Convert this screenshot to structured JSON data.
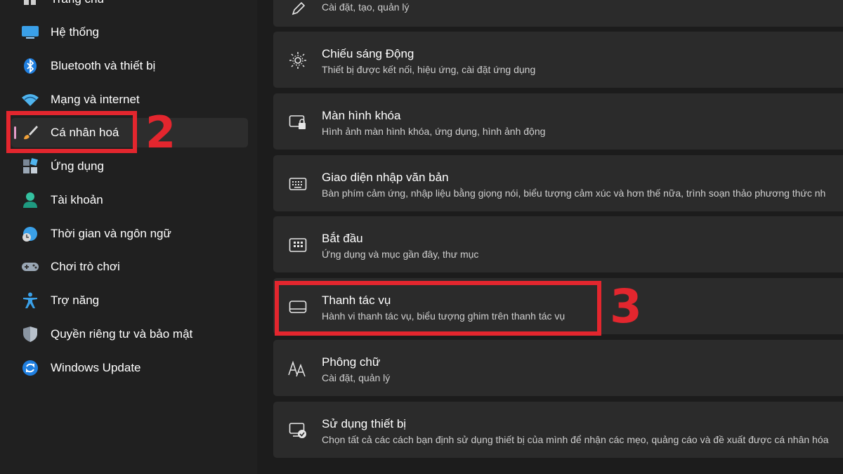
{
  "sidebar": {
    "items": [
      {
        "label": "Trang chủ",
        "icon": "home-icon"
      },
      {
        "label": "Hệ thống",
        "icon": "system-icon"
      },
      {
        "label": "Bluetooth và thiết bị",
        "icon": "bluetooth-icon"
      },
      {
        "label": "Mạng và internet",
        "icon": "wifi-icon"
      },
      {
        "label": "Cá nhân hoá",
        "icon": "brush-icon",
        "active": true
      },
      {
        "label": "Ứng dụng",
        "icon": "apps-icon"
      },
      {
        "label": "Tài khoản",
        "icon": "account-icon"
      },
      {
        "label": "Thời gian và ngôn ngữ",
        "icon": "time-language-icon"
      },
      {
        "label": "Chơi trò chơi",
        "icon": "gamepad-icon"
      },
      {
        "label": "Trợ năng",
        "icon": "accessibility-icon"
      },
      {
        "label": "Quyền riêng tư và bảo mật",
        "icon": "shield-icon"
      },
      {
        "label": "Windows Update",
        "icon": "update-icon"
      }
    ]
  },
  "main": {
    "top_subtitle": "Cài đặt, tạo, quản lý",
    "cards": [
      {
        "title": "Chiếu sáng Động",
        "subtitle": "Thiết bị được kết nối, hiệu ứng, cài đặt ứng dụng",
        "icon": "dynamic-lighting-icon"
      },
      {
        "title": "Màn hình khóa",
        "subtitle": "Hình ảnh màn hình khóa, ứng dụng, hình ảnh động",
        "icon": "lock-screen-icon"
      },
      {
        "title": "Giao diện nhập văn bản",
        "subtitle": "Bàn phím cảm ứng, nhập liệu bằng giọng nói, biểu tượng cảm xúc và hơn thế nữa, trình soạn thảo phương thức nh",
        "icon": "keyboard-icon"
      },
      {
        "title": "Bắt đầu",
        "subtitle": "Ứng dụng và mục gần đây, thư mục",
        "icon": "start-icon"
      },
      {
        "title": "Thanh tác vụ",
        "subtitle": "Hành vi thanh tác vụ, biểu tượng ghim trên thanh tác vụ",
        "icon": "taskbar-icon"
      },
      {
        "title": "Phông chữ",
        "subtitle": "Cài đặt, quản lý",
        "icon": "fonts-icon"
      },
      {
        "title": "Sử dụng thiết bị",
        "subtitle": "Chọn tất cả các cách bạn định sử dụng thiết bị của mình để nhận các mẹo, quảng cáo và đề xuất được cá nhân hóa",
        "icon": "device-usage-icon"
      }
    ]
  },
  "annotations": {
    "step2": "2",
    "step3": "3",
    "color": "#e3262e"
  },
  "colors": {
    "background": "#202020",
    "card": "#2b2b2b",
    "active_indicator": "#e59cc9"
  }
}
